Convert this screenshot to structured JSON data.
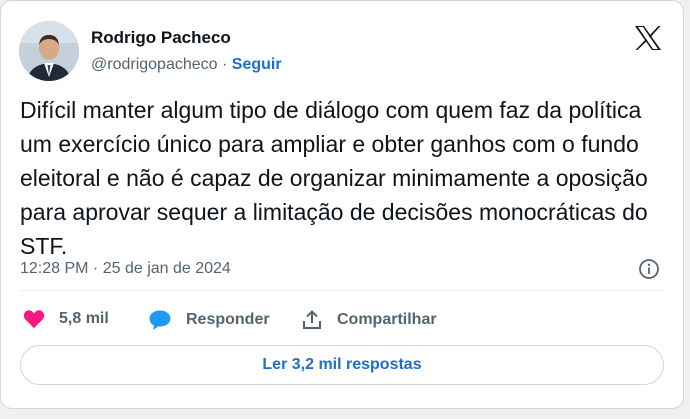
{
  "tweet": {
    "author_name": "Rodrigo Pacheco",
    "handle": "@rodrigopacheco",
    "separator": "·",
    "follow_label": "Seguir",
    "text": "Difícil manter algum tipo de diálogo com quem faz da política um exercício único para ampliar e obter ganhos com o fundo eleitoral e não é capaz de organizar minimamente a oposição para aprovar sequer a limitação de decisões monocráticas do STF.",
    "timestamp": "12:28 PM · 25 de jan de 2024"
  },
  "actions": {
    "like_count": "5,8 mil",
    "reply_label": "Responder",
    "share_label": "Compartilhar"
  },
  "replies_button": "Ler 3,2 mil respostas",
  "icons": {
    "brand": "x-logo-icon",
    "info": "info-icon",
    "like": "heart-icon",
    "reply": "speech-bubble-icon",
    "share": "share-icon"
  },
  "colors": {
    "accent": "#1d6fc9",
    "like": "#f91880",
    "reply": "#1d9bf0",
    "text": "#0f1419",
    "muted": "#536471"
  }
}
